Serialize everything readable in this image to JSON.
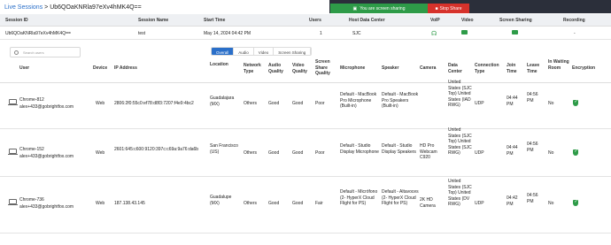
{
  "window": {
    "breadcrumb_root": "Live Sessions",
    "breadcrumb_current": "Ub6QOaKNRla97eXv4hMK4Q==",
    "banner_text": "You are screen sharing",
    "stop_share_label": "Stop Share"
  },
  "session_table": {
    "headers": [
      "Session ID",
      "Session Name",
      "Start Time",
      "Users",
      "Host Data Center",
      "VoIP",
      "Video",
      "Screen Sharing",
      "Recording"
    ],
    "row": {
      "session_id": "Ub6QOaKNRla97eXv4hMK4Q==",
      "session_name": "test",
      "start_time": "May 14, 2024 04:42 PM",
      "users": "1",
      "host_dc": "SJC",
      "recording": "-",
      "voip_color": "#2e9b48",
      "video_color": "#2e9b48",
      "screen_color": "#2e9b48"
    }
  },
  "search": {
    "placeholder": "Search users"
  },
  "tabs": [
    {
      "label": "Overall",
      "active": true
    },
    {
      "label": "Audio",
      "active": false
    },
    {
      "label": "Video",
      "active": false
    },
    {
      "label": "Screen Sharing",
      "active": false
    }
  ],
  "grid_headers": [
    "User",
    "Device",
    "IP Address",
    "Location",
    "Network Type",
    "Audio Quality",
    "Video Quality",
    "Screen Share Quality",
    "Microphone",
    "Speaker",
    "Camera",
    "Data Center",
    "Connection Type",
    "Join Time",
    "Leave Time",
    "In Waiting Room",
    "Encryption"
  ],
  "users": [
    {
      "name": "Chrome-812",
      "email": "alex+433@gobrightfox.com",
      "device": "Web",
      "ip": "2806:2f0:55c0:ef78:d8f3:7207:f4e9:4bc2",
      "location": "Guadalajara (MX)",
      "network": "Others",
      "audio": "Good",
      "video": "Good",
      "screen": "Poor",
      "mic": "Default - MacBook Pro Microphone (Built-in)",
      "speaker": "Default - MacBook Pro Speakers (Built-in)",
      "camera": "",
      "dc": "United States (SJC Top) United States (IAD RWG)",
      "conn": "UDP",
      "join": "04:44 PM",
      "leave": "04:56 PM",
      "waiting": "No"
    },
    {
      "name": "Chrome-152",
      "email": "alex+433@gobrightfox.com",
      "device": "Web",
      "ip": "2601:645:c600:9120:397c:c69a:9a76:da6b",
      "location": "San Francisco (US)",
      "network": "Others",
      "audio": "Good",
      "video": "Good",
      "screen": "Poor",
      "mic": "Default - Studio Display Microphone",
      "speaker": "Default - Studio Display Speakers",
      "camera": "HD Pro Webcam C920",
      "dc": "United States (SJC Top) United States (SJC RWG)",
      "conn": "UDP",
      "join": "04:44 PM",
      "leave": "04:56 PM",
      "waiting": "No"
    },
    {
      "name": "Chrome-736",
      "email": "alex+433@gobrightfox.com",
      "device": "Web",
      "ip": "187.138.43.145",
      "location": "Guadalupe (MX)",
      "network": "Others",
      "audio": "Good",
      "video": "Good",
      "screen": "Fair",
      "mic": "Default - Micrófono (2- HyperX Cloud Flight for PS)",
      "speaker": "Default - Altavoces (2- HyperX Cloud Flight for PS)",
      "camera": "2K HD Camera",
      "dc": "United States (SJC Top) United States (DV RWG)",
      "conn": "UDP",
      "join": "04:42 PM",
      "leave": "04:56 PM",
      "waiting": "No"
    }
  ],
  "colors": {
    "accent": "#2a6fc9",
    "good": "#2e9b48",
    "warning": "#d9822b",
    "danger": "#d6322b"
  }
}
